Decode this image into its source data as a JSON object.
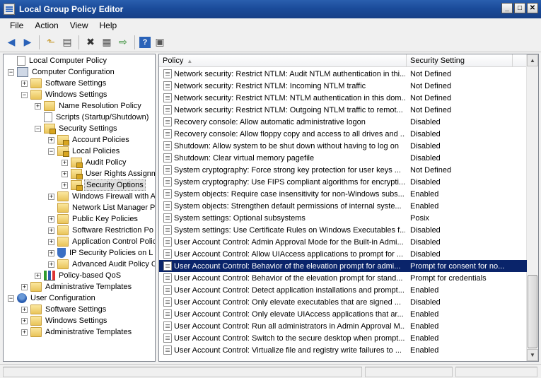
{
  "window": {
    "title": "Local Group Policy Editor"
  },
  "menu": [
    "File",
    "Action",
    "View",
    "Help"
  ],
  "toolbar": [
    "back-icon",
    "forward-icon",
    "up-icon",
    "show-hide-tree-icon",
    "delete-icon",
    "properties-icon",
    "export-icon",
    "help-icon",
    "show-hide-action-pane-icon"
  ],
  "tree": [
    {
      "label": "Local Computer Policy",
      "level": 0,
      "exp": "",
      "icon": "doc"
    },
    {
      "label": "Computer Configuration",
      "level": 0,
      "exp": "−",
      "icon": "computer"
    },
    {
      "label": "Software Settings",
      "level": 1,
      "exp": "+",
      "icon": "folder"
    },
    {
      "label": "Windows Settings",
      "level": 1,
      "exp": "−",
      "icon": "folder"
    },
    {
      "label": "Name Resolution Policy",
      "level": 2,
      "exp": "+",
      "icon": "folder"
    },
    {
      "label": "Scripts (Startup/Shutdown)",
      "level": 2,
      "exp": "",
      "icon": "doc"
    },
    {
      "label": "Security Settings",
      "level": 2,
      "exp": "−",
      "icon": "lockfolder"
    },
    {
      "label": "Account Policies",
      "level": 3,
      "exp": "+",
      "icon": "lockfolder"
    },
    {
      "label": "Local Policies",
      "level": 3,
      "exp": "−",
      "icon": "lockfolder"
    },
    {
      "label": "Audit Policy",
      "level": 4,
      "exp": "+",
      "icon": "lockfolder"
    },
    {
      "label": "User Rights Assignm",
      "level": 4,
      "exp": "+",
      "icon": "lockfolder"
    },
    {
      "label": "Security Options",
      "level": 4,
      "exp": "+",
      "icon": "lockfolder",
      "selected": true
    },
    {
      "label": "Windows Firewall with A",
      "level": 3,
      "exp": "+",
      "icon": "folder"
    },
    {
      "label": "Network List Manager P",
      "level": 3,
      "exp": "",
      "icon": "folder"
    },
    {
      "label": "Public Key Policies",
      "level": 3,
      "exp": "+",
      "icon": "folder"
    },
    {
      "label": "Software Restriction Po",
      "level": 3,
      "exp": "+",
      "icon": "folder"
    },
    {
      "label": "Application Control Polic",
      "level": 3,
      "exp": "+",
      "icon": "folder"
    },
    {
      "label": "IP Security Policies on L",
      "level": 3,
      "exp": "+",
      "icon": "shield"
    },
    {
      "label": "Advanced Audit Policy C",
      "level": 3,
      "exp": "+",
      "icon": "folder"
    },
    {
      "label": "Policy-based QoS",
      "level": 2,
      "exp": "+",
      "icon": "chart"
    },
    {
      "label": "Administrative Templates",
      "level": 1,
      "exp": "+",
      "icon": "folder"
    },
    {
      "label": "User Configuration",
      "level": 0,
      "exp": "−",
      "icon": "userico"
    },
    {
      "label": "Software Settings",
      "level": 1,
      "exp": "+",
      "icon": "folder"
    },
    {
      "label": "Windows Settings",
      "level": 1,
      "exp": "+",
      "icon": "folder"
    },
    {
      "label": "Administrative Templates",
      "level": 1,
      "exp": "+",
      "icon": "folder"
    }
  ],
  "list": {
    "columns": [
      "Policy",
      "Security Setting"
    ],
    "rows": [
      {
        "policy": "Network security: Restrict NTLM: Audit NTLM authentication in thi...",
        "setting": "Not Defined"
      },
      {
        "policy": "Network security: Restrict NTLM: Incoming NTLM traffic",
        "setting": "Not Defined"
      },
      {
        "policy": "Network security: Restrict NTLM: NTLM authentication in this dom...",
        "setting": "Not Defined"
      },
      {
        "policy": "Network security: Restrict NTLM: Outgoing NTLM traffic to remot...",
        "setting": "Not Defined"
      },
      {
        "policy": "Recovery console: Allow automatic administrative logon",
        "setting": "Disabled"
      },
      {
        "policy": "Recovery console: Allow floppy copy and access to all drives and ...",
        "setting": "Disabled"
      },
      {
        "policy": "Shutdown: Allow system to be shut down without having to log on",
        "setting": "Disabled"
      },
      {
        "policy": "Shutdown: Clear virtual memory pagefile",
        "setting": "Disabled"
      },
      {
        "policy": "System cryptography: Force strong key protection for user keys ...",
        "setting": "Not Defined"
      },
      {
        "policy": "System cryptography: Use FIPS compliant algorithms for encrypti...",
        "setting": "Disabled"
      },
      {
        "policy": "System objects: Require case insensitivity for non-Windows subs...",
        "setting": "Enabled"
      },
      {
        "policy": "System objects: Strengthen default permissions of internal syste...",
        "setting": "Enabled"
      },
      {
        "policy": "System settings: Optional subsystems",
        "setting": "Posix"
      },
      {
        "policy": "System settings: Use Certificate Rules on Windows Executables f...",
        "setting": "Disabled"
      },
      {
        "policy": "User Account Control: Admin Approval Mode for the Built-in Admi...",
        "setting": "Disabled"
      },
      {
        "policy": "User Account Control: Allow UIAccess applications to prompt for ...",
        "setting": "Disabled"
      },
      {
        "policy": "User Account Control: Behavior of the elevation prompt for admi...",
        "setting": "Prompt for consent for no...",
        "selected": true
      },
      {
        "policy": "User Account Control: Behavior of the elevation prompt for stand...",
        "setting": "Prompt for credentials"
      },
      {
        "policy": "User Account Control: Detect application installations and prompt...",
        "setting": "Enabled"
      },
      {
        "policy": "User Account Control: Only elevate executables that are signed ...",
        "setting": "Disabled"
      },
      {
        "policy": "User Account Control: Only elevate UIAccess applications that ar...",
        "setting": "Enabled"
      },
      {
        "policy": "User Account Control: Run all administrators in Admin Approval M...",
        "setting": "Enabled"
      },
      {
        "policy": "User Account Control: Switch to the secure desktop when prompt...",
        "setting": "Enabled"
      },
      {
        "policy": "User Account Control: Virtualize file and registry write failures to ...",
        "setting": "Enabled"
      }
    ]
  },
  "colors": {
    "titlebar": "#1b4c9b",
    "selection": "#0a246a"
  }
}
